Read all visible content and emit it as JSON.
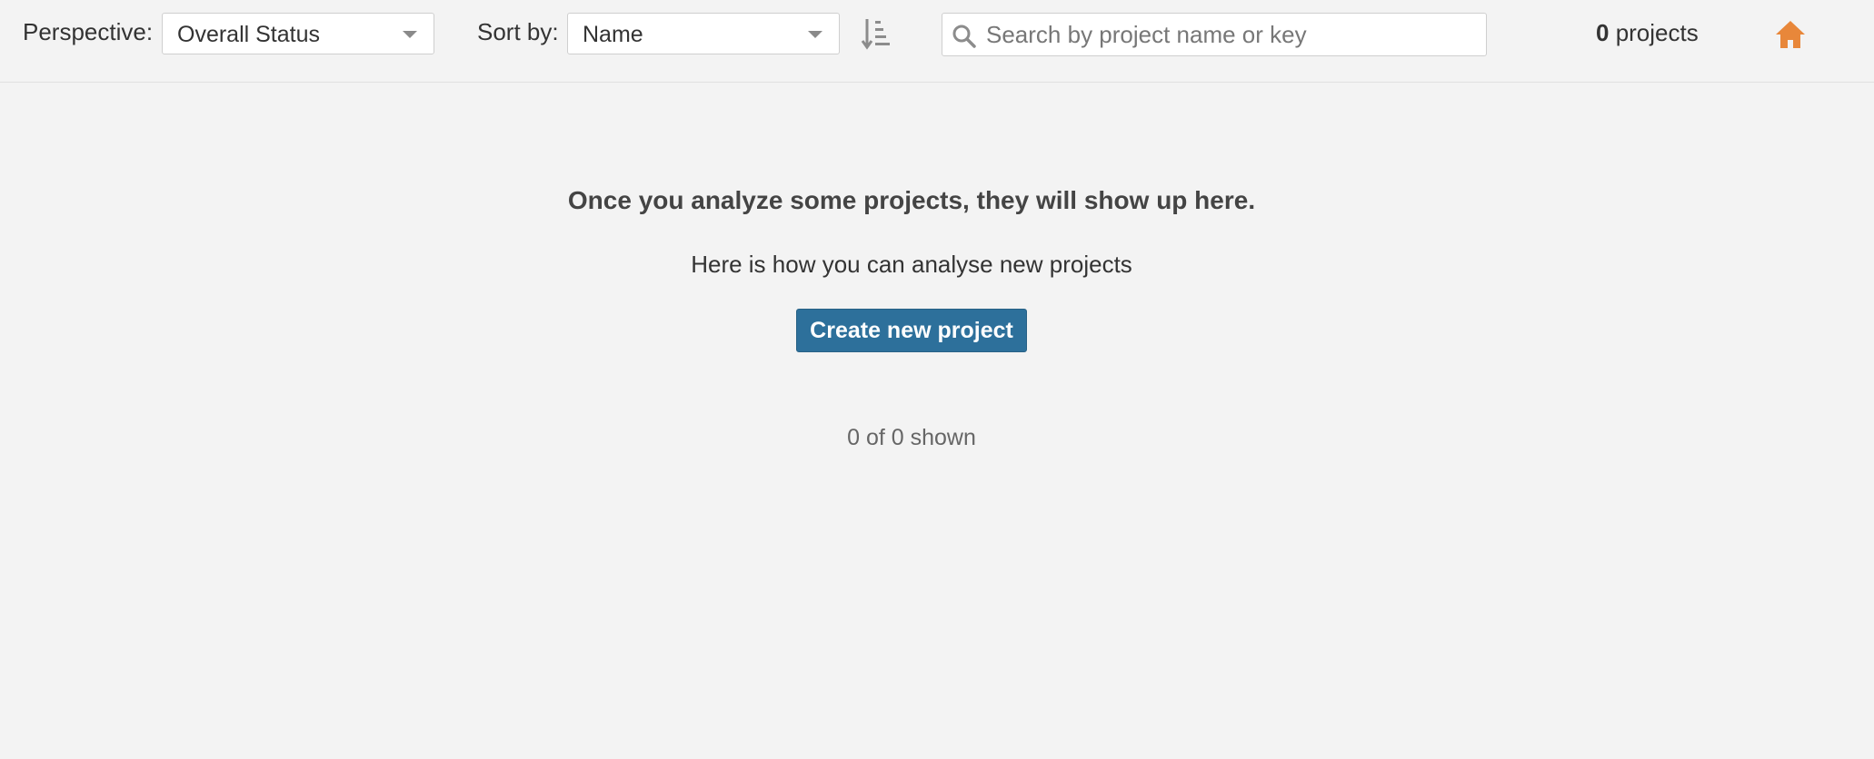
{
  "toolbar": {
    "perspective_label": "Perspective:",
    "perspective_value": "Overall Status",
    "sort_label": "Sort by:",
    "sort_value": "Name",
    "search_placeholder": "Search by project name or key",
    "search_value": "",
    "project_count": "0",
    "project_count_suffix": " projects"
  },
  "empty_state": {
    "title": "Once you analyze some projects, they will show up here.",
    "subtitle": "Here is how you can analyse new projects",
    "create_button": "Create new project"
  },
  "footer": {
    "shown": "0 of 0 shown"
  },
  "icons": {
    "sort": "sort-ascending-icon",
    "search": "search-icon",
    "home": "home-icon",
    "caret": "chevron-down-icon"
  },
  "colors": {
    "accent": "#236a97",
    "home_icon": "#e8873a",
    "background": "#f3f3f3"
  }
}
